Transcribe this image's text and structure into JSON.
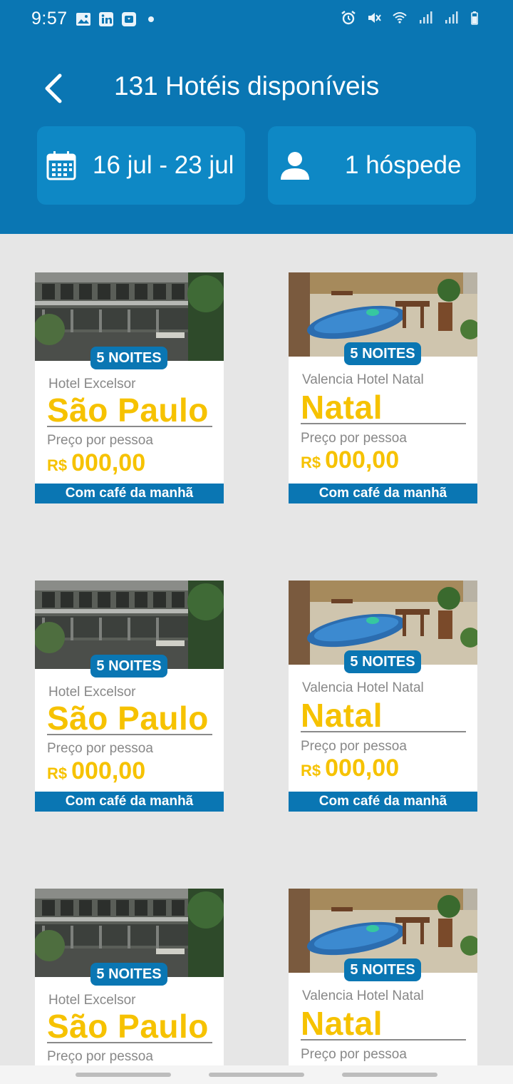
{
  "status_bar": {
    "time": "9:57",
    "left_icons": [
      "gallery-icon",
      "linkedin-icon",
      "download-icon",
      "notification-dot"
    ],
    "right_icons": [
      "alarm-icon",
      "mute-icon",
      "wifi-icon",
      "signal-icon",
      "signal-icon-2",
      "battery-icon"
    ]
  },
  "header": {
    "title": "131 Hotéis disponíveis",
    "dates_label": "16 jul - 23 jul",
    "guests_label": "1 hóspede",
    "background": "#0a76b3",
    "chip_color": "#0e88c5"
  },
  "cards": [
    {
      "badge": "5 NOITES",
      "hotel": "Hotel Excelsor",
      "city": "São Paulo",
      "price_label": "Preço por pessoa",
      "currency": "R$",
      "price": "000,00",
      "breakfast": "Com café da manhã"
    },
    {
      "badge": "5 NOITES",
      "hotel": "Valencia Hotel Natal",
      "city": "Natal",
      "price_label": "Preço por pessoa",
      "currency": "R$",
      "price": "000,00",
      "breakfast": "Com café da manhã"
    },
    {
      "badge": "5 NOITES",
      "hotel": "Hotel Excelsor",
      "city": "São Paulo",
      "price_label": "Preço por pessoa",
      "currency": "R$",
      "price": "000,00",
      "breakfast": "Com café da manhã"
    },
    {
      "badge": "5 NOITES",
      "hotel": "Valencia Hotel Natal",
      "city": "Natal",
      "price_label": "Preço por pessoa",
      "currency": "R$",
      "price": "000,00",
      "breakfast": "Com café da manhã"
    },
    {
      "badge": "5 NOITES",
      "hotel": "Hotel Excelsor",
      "city": "São Paulo",
      "price_label": "Preço por pessoa"
    },
    {
      "badge": "5 NOITES",
      "hotel": "Valencia Hotel Natal",
      "city": "Natal",
      "price_label": "Preço por pessoa"
    }
  ],
  "colors": {
    "accent_yellow": "#f6c200",
    "brand_blue": "#0a76b3",
    "grey_text": "#888888"
  }
}
